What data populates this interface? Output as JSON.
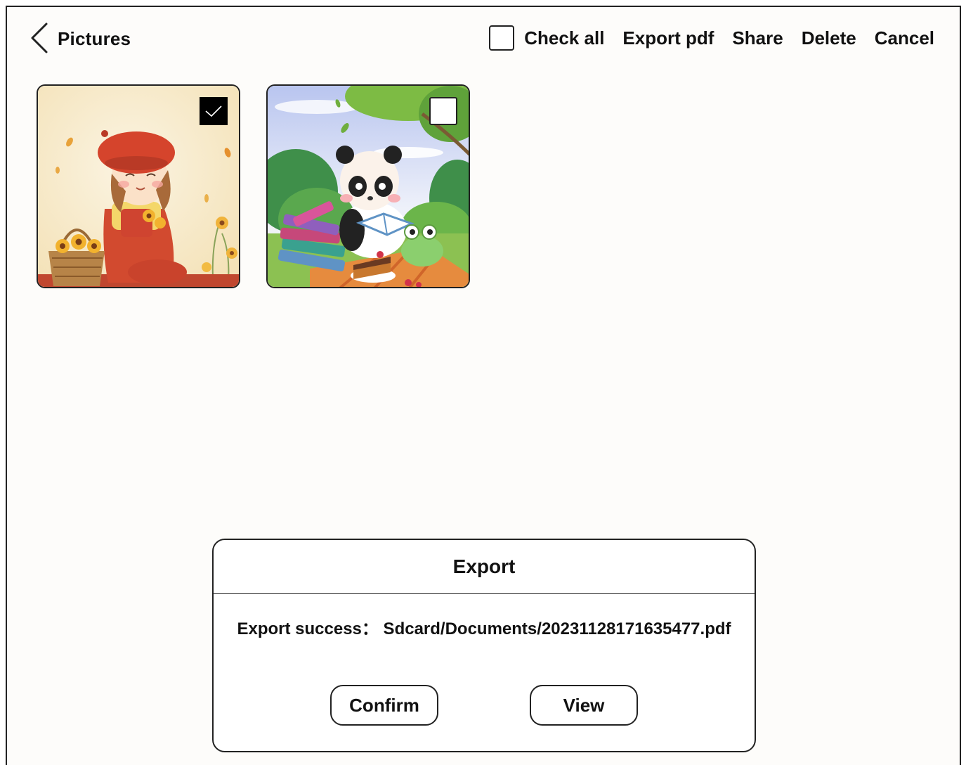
{
  "header": {
    "title": "Pictures",
    "back_icon": "chevron-left-icon"
  },
  "toolbar": {
    "check_all_label": "Check all",
    "check_all_checked": false,
    "export_pdf_label": "Export pdf",
    "share_label": "Share",
    "delete_label": "Delete",
    "cancel_label": "Cancel"
  },
  "pictures": [
    {
      "subject": "girl-with-sunflower-basket",
      "checked": true
    },
    {
      "subject": "panda-reading-book",
      "checked": false
    }
  ],
  "dialog": {
    "title": "Export",
    "message": "Export success： Sdcard/Documents/20231128171635477.pdf",
    "confirm_label": "Confirm",
    "view_label": "View"
  }
}
